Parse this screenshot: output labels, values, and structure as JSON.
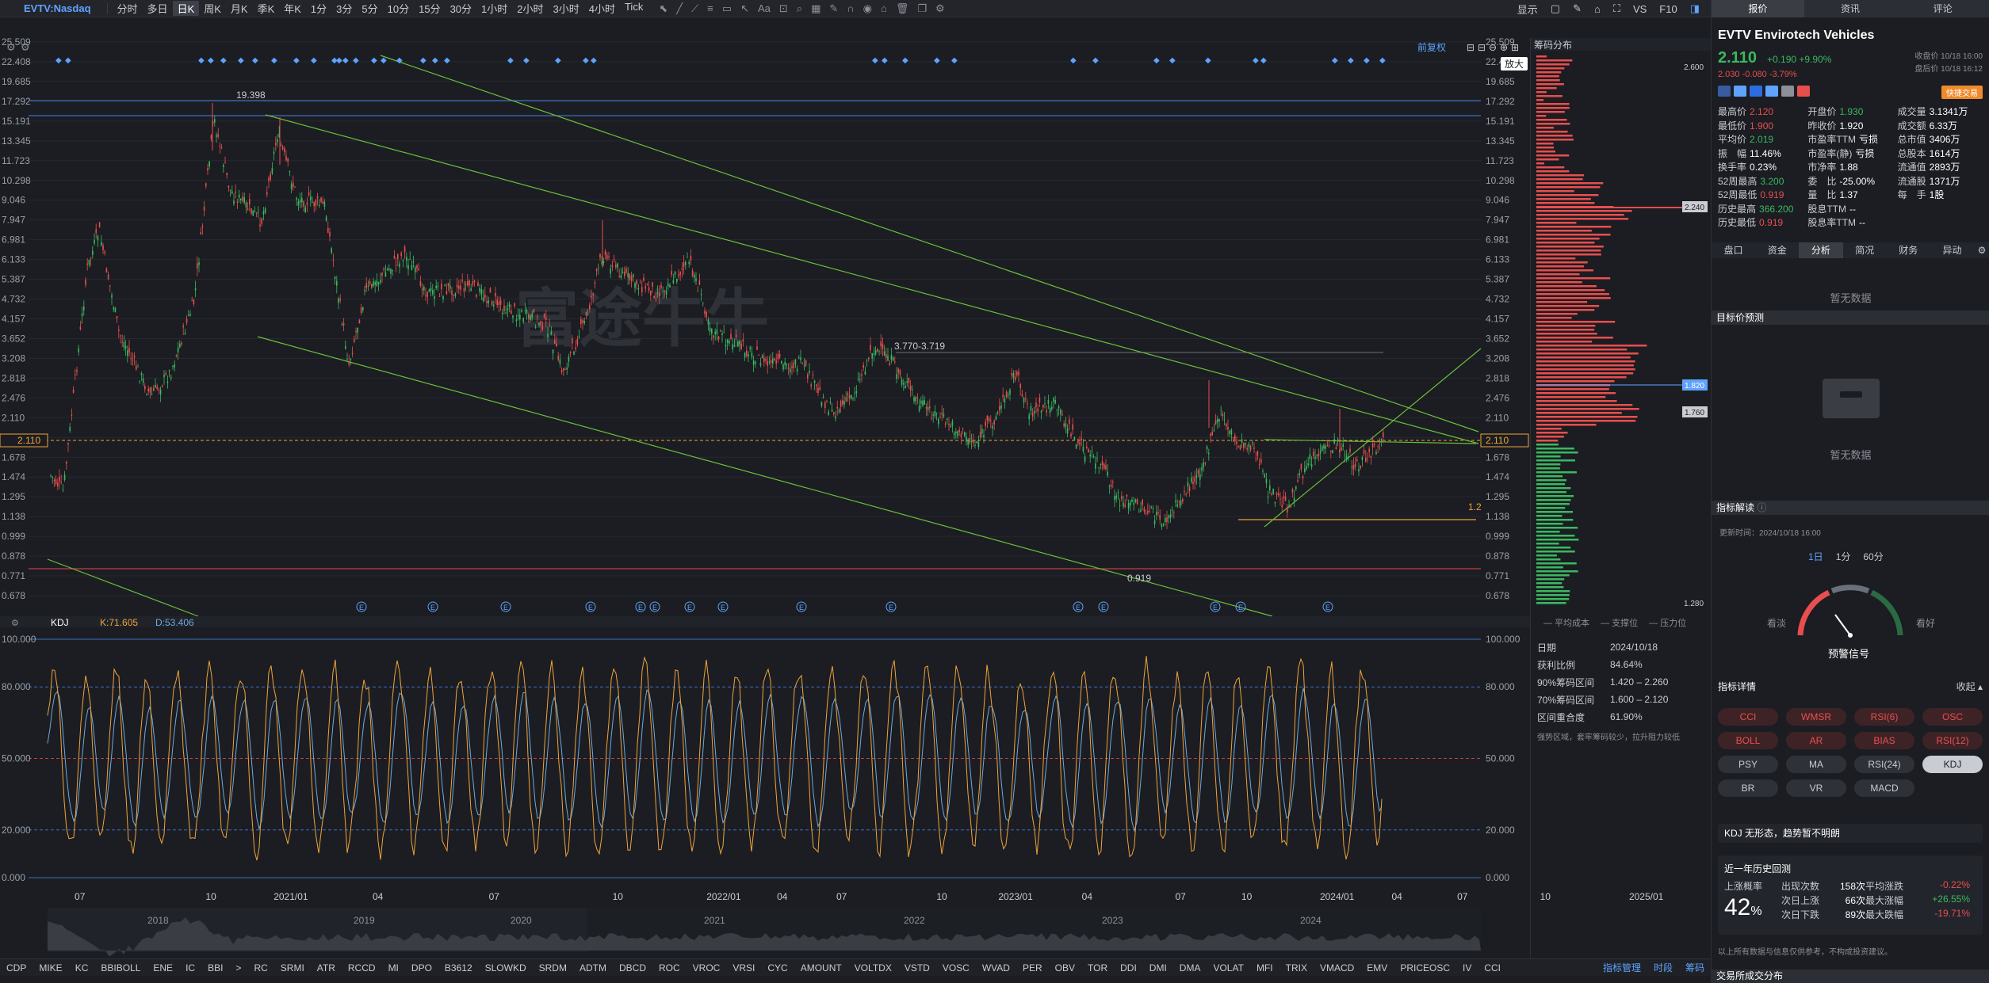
{
  "toolbar": {
    "symbol": "EVTV:Nasdaq",
    "periods": [
      "分时",
      "多日",
      "日K",
      "周K",
      "月K",
      "季K",
      "年K",
      "1分",
      "3分",
      "5分",
      "10分",
      "15分",
      "30分",
      "1小时",
      "2小时",
      "3小时",
      "4小时",
      "Tick"
    ],
    "active_period": "日K",
    "right": {
      "display": "显示",
      "vs": "VS",
      "f10": "F10"
    }
  },
  "chart": {
    "restore_label": "前复权",
    "zoom_tooltip": "放大",
    "price_ticks": [
      "25.509",
      "22.408",
      "19.685",
      "17.292",
      "15.191",
      "13.345",
      "11.723",
      "10.298",
      "9.046",
      "7.947",
      "6.981",
      "6.133",
      "5.387",
      "4.732",
      "4.157",
      "3.652",
      "3.208",
      "2.818",
      "2.476",
      "2.110",
      "1.910",
      "1.678",
      "1.474",
      "1.295",
      "1.138",
      "0.999",
      "0.878",
      "0.771",
      "0.678"
    ],
    "current_price": "2.110",
    "annotations": {
      "high": "19.398",
      "low": "0.919",
      "range": "3.770-3.719",
      "target": "1.2"
    },
    "watermark": "富途牛牛",
    "time_labels": [
      "07",
      "10",
      "2021/01",
      "04",
      "07",
      "10",
      "2022/01",
      "04",
      "07",
      "10",
      "2023/01",
      "04",
      "07",
      "10",
      "2024/01",
      "04",
      "07",
      "10",
      "2025/01"
    ],
    "overview_years": [
      "2018",
      "2019",
      "2020",
      "2021",
      "2022",
      "2023",
      "2024"
    ]
  },
  "kdj": {
    "name": "KDJ",
    "k_label": "K:71.605",
    "d_label": "D:53.406",
    "ticks": [
      "100.000",
      "80.000",
      "50.000",
      "20.000",
      "0.000"
    ]
  },
  "chip": {
    "title": "筹码分布",
    "top_label": "2.600",
    "bottom_label": "1.280",
    "tag_2240": "2.240",
    "tag_1820": "1.820",
    "tag_1760": "1.760",
    "legend": [
      "平均成本",
      "支撑位",
      "压力位"
    ],
    "stats": [
      [
        "日期",
        "2024/10/18"
      ],
      [
        "获利比例",
        "84.64%"
      ],
      [
        "90%筹码区间",
        "1.420 – 2.260"
      ],
      [
        "70%筹码区间",
        "1.600 – 2.120"
      ],
      [
        "区间重合度",
        "61.90%"
      ]
    ],
    "note": "强势区域，套牢筹码较少，拉升阻力较低"
  },
  "indicators_bar": [
    "CDP",
    "MIKE",
    "KC",
    "BBIBOLL",
    "ENE",
    "IC",
    "BBI",
    ">",
    "RC",
    "SRMI",
    "ATR",
    "RCCD",
    "MI",
    "DPO",
    "B3612",
    "SLOWKD",
    "SRDM",
    "ADTM",
    "DBCD",
    "ROC",
    "VROC",
    "VRSI",
    "CYC",
    "AMOUNT",
    "VOLTDX",
    "VSTD",
    "VOSC",
    "WVAD",
    "PER",
    "OBV",
    "TOR",
    "DDI",
    "DMI",
    "DMA",
    "VOLAT",
    "MFI",
    "TRIX",
    "VMACD",
    "EMV",
    "PRICEOSC",
    "IV",
    "CCI"
  ],
  "indicators_bar_right": [
    "指标管理",
    "时段",
    "筹码"
  ],
  "right_panel": {
    "tabs": [
      "报价",
      "资讯",
      "评论"
    ],
    "title": "EVTV  Envirotech Vehicles",
    "price": "2.110",
    "change": "+0.190 +9.90%",
    "after_price": "2.030",
    "after_change": "-0.080 -3.79%",
    "close_time": "收盘价 10/18 16:00",
    "after_time": "盘后价 10/18 16:12",
    "fast_trade": "快捷交易",
    "quote": [
      [
        [
          "最高价",
          "2.120",
          "red"
        ],
        [
          "开盘价",
          "1.930",
          "green"
        ],
        [
          "成交量",
          "3.1341万",
          ""
        ]
      ],
      [
        [
          "最低价",
          "1.900",
          "red"
        ],
        [
          "昨收价",
          "1.920",
          ""
        ],
        [
          "成交额",
          "6.33万",
          ""
        ]
      ],
      [
        [
          "平均价",
          "2.019",
          "green"
        ],
        [
          "市盈率TTM",
          "亏损",
          ""
        ],
        [
          "总市值",
          "3406万",
          ""
        ]
      ],
      [
        [
          "振　幅",
          "11.46%",
          ""
        ],
        [
          "市盈率(静)",
          "亏损",
          ""
        ],
        [
          "总股本",
          "1614万",
          ""
        ]
      ],
      [
        [
          "换手率",
          "0.23%",
          ""
        ],
        [
          "市净率",
          "1.88",
          ""
        ],
        [
          "流通值",
          "2893万",
          ""
        ]
      ],
      [
        [
          "52周最高",
          "3.200",
          "green"
        ],
        [
          "委　比",
          "-25.00%",
          ""
        ],
        [
          "流通股",
          "1371万",
          ""
        ]
      ],
      [
        [
          "52周最低",
          "0.919",
          "red"
        ],
        [
          "量　比",
          "1.37",
          ""
        ],
        [
          "每　手",
          "1股",
          ""
        ]
      ],
      [
        [
          "历史最高",
          "366.200",
          "green"
        ],
        [
          "股息TTM",
          "--",
          ""
        ],
        [
          "",
          "",
          ""
        ]
      ],
      [
        [
          "历史最低",
          "0.919",
          "red"
        ],
        [
          "股息率TTM",
          "--",
          ""
        ],
        [
          "",
          "",
          ""
        ]
      ]
    ],
    "subtabs": [
      "盘口",
      "资金",
      "分析",
      "简况",
      "财务",
      "异动"
    ],
    "active_subtab": "分析",
    "empty1": "暂无数据",
    "target_title": "目标价预测",
    "empty2": "暂无数据",
    "interp_title": "指标解读",
    "update_time": "更新时间：2024/10/18 16:00",
    "periods": [
      "1日",
      "1分",
      "60分"
    ],
    "gauge_left": "看淡",
    "gauge_right": "看好",
    "gauge_title": "预警信号",
    "detail_title": "指标详情",
    "collapse": "收起",
    "pills": [
      [
        "CCI",
        "r"
      ],
      [
        "WMSR",
        "r"
      ],
      [
        "RSI(6)",
        "r"
      ],
      [
        "OSC",
        "r"
      ],
      [
        "BOLL",
        "r"
      ],
      [
        "AR",
        "r"
      ],
      [
        "BIAS",
        "r"
      ],
      [
        "RSI(12)",
        "r"
      ],
      [
        "PSY",
        "g"
      ],
      [
        "MA",
        "g"
      ],
      [
        "RSI(24)",
        "g"
      ],
      [
        "KDJ",
        "a"
      ],
      [
        "BR",
        "g"
      ],
      [
        "VR",
        "g"
      ],
      [
        "MACD",
        "g"
      ]
    ],
    "kdj_status": "KDJ 无形态，趋势暂不明朗",
    "hist_title": "近一年历史回测",
    "up_prob_label": "上涨概率",
    "up_prob": "42",
    "hist_rows": [
      [
        "出现次数",
        "158次",
        "平均涨跌",
        "-0.22%"
      ],
      [
        "次日上涨",
        "66次",
        "最大涨幅",
        "+26.55%"
      ],
      [
        "次日下跌",
        "89次",
        "最大跌幅",
        "-19.71%"
      ]
    ],
    "disclaimer": "以上所有数据与信息仅供参考，不构成投资建议。",
    "footer": "交易所成交分布"
  },
  "colors": {
    "up": "#e94e4e",
    "down": "#3bb861",
    "accent": "#5fa3ff",
    "k": "#f0a33a",
    "d": "#6fa8dc"
  }
}
